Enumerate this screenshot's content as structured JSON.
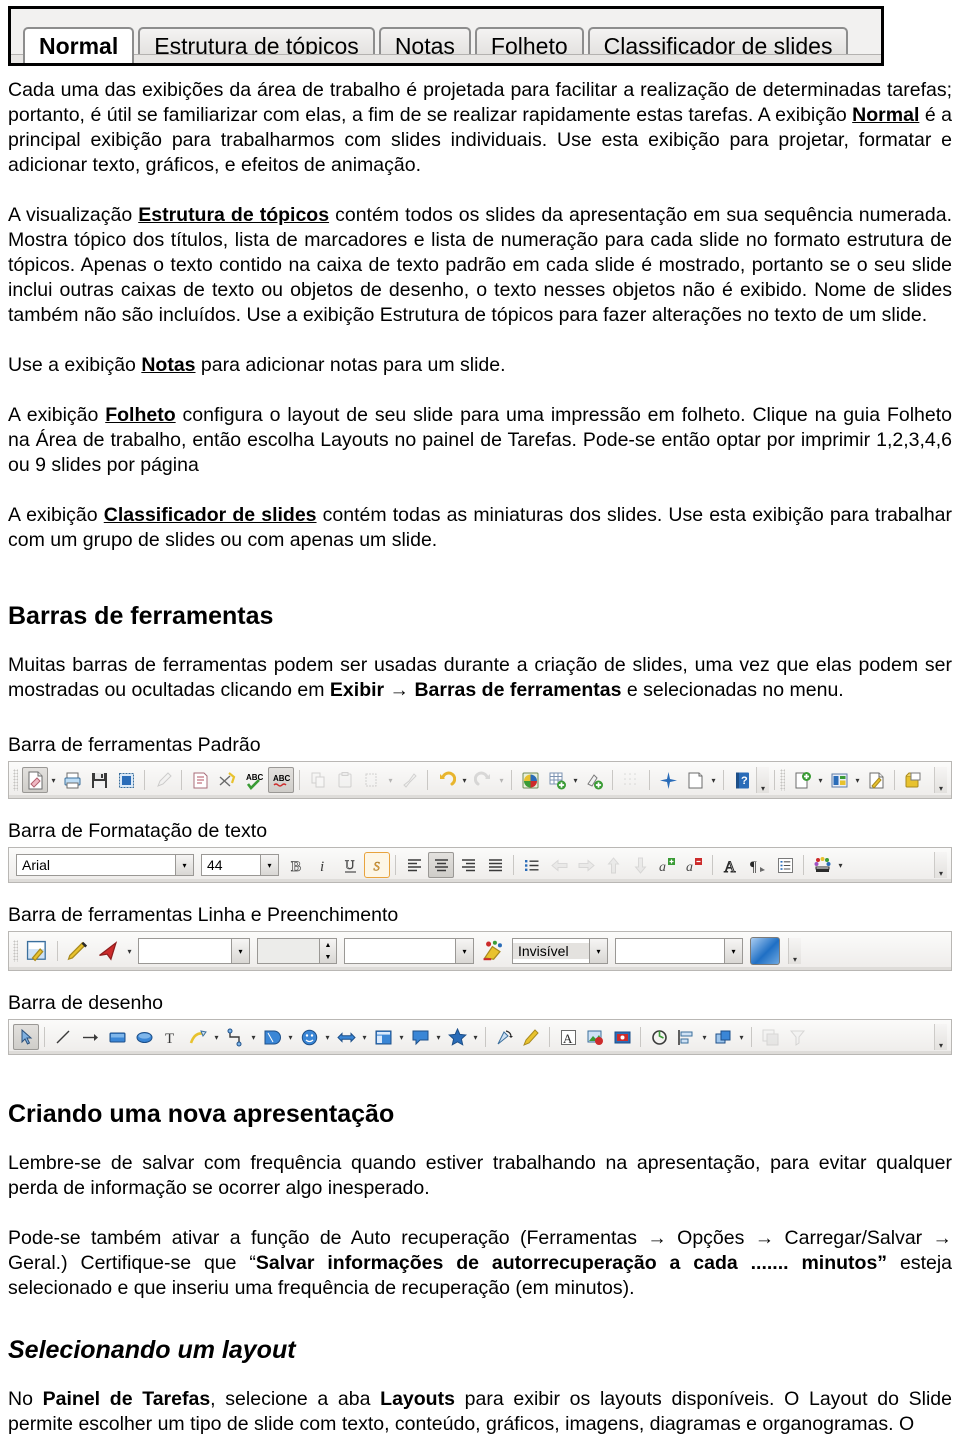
{
  "view_tabs": {
    "items": [
      {
        "label": "Normal",
        "active": true
      },
      {
        "label": "Estrutura de tópicos",
        "active": false
      },
      {
        "label": "Notas",
        "active": false
      },
      {
        "label": "Folheto",
        "active": false
      },
      {
        "label": "Classificador de slides",
        "active": false
      }
    ]
  },
  "body": {
    "p1_a": "Cada uma das  exibições  da área de trabalho  é  projetada para facilitar a realização de determinadas tarefas; portanto, é útil se familiarizar com elas, a fim de se realizar rapidamente estas tarefas. A exibição ",
    "p1_term": "Normal",
    "p1_b": " é a principal exibição para trabalharmos com slides individuais. Use esta exibição para projetar, formatar e adicionar texto, gráficos, e efeitos de animação.",
    "p2_a": "A visualização ",
    "p2_term": "Estrutura de tópicos",
    "p2_b": " contém todos os slides da apresentação em sua sequência numerada. Mostra tópico dos títulos, lista de marcadores e lista de numeração para cada  slide no formato estrutura de tópicos. Apenas o texto contido na caixa de texto padrão em cada slide é mostrado, portanto se o seu slide inclui outras caixas de texto ou objetos de desenho, o texto nesses objetos não é exibido. Nome de slides também não são incluídos. Use a exibição Estrutura de tópicos para fazer alterações no texto de um slide.",
    "p3_a": "Use a exibição ",
    "p3_term": "Notas",
    "p3_b": " para adicionar notas para um slide.",
    "p4_a": "A exibição ",
    "p4_term": "Folheto",
    "p4_b": " configura o layout de seu slide para uma impressão em folheto. Clique na guia Folheto na Área de trabalho, então escolha Layouts no painel de Tarefas. Pode-se então optar por imprimir 1,2,3,4,6 ou 9 slides por página",
    "p5_a": "A exibição ",
    "p5_term": "Classificador de slides",
    "p5_b": " contém todas as miniaturas dos slides. Use esta exibição para trabalhar com um grupo de slides ou com apenas um slide.",
    "h_toolbars": "Barras de ferramentas",
    "p6_a": "Muitas barras de ferramentas podem ser usadas durante a criação de slides, uma vez que elas podem ser mostradas ou ocultadas clicando em ",
    "p6_b1": "Exibir",
    "p6_arrow": " → ",
    "p6_b2": "Barras de ferramentas",
    "p6_c": " e selecionadas no menu.",
    "cap_standard": "Barra de ferramentas Padrão",
    "cap_textformat": "Barra de Formatação de texto",
    "cap_linefill": "Barra de ferramentas Linha e Preenchimento",
    "cap_drawing": "Barra de desenho",
    "h_newpres": "Criando uma nova apresentação",
    "p7": "Lembre-se de salvar com frequência quando estiver trabalhando  na apresentação, para evitar qualquer perda de informação se ocorrer algo inesperado.",
    "p8_a": "Pode-se também ativar a função de Auto recuperação (Ferramentas → Opções → Carregar/Salvar → Geral.) Certifique-se que  “",
    "p8_bold": "Salvar informações de autorrecuperação a cada ....... minutos”",
    "p8_b": " esteja selecionado e que inseriu uma frequência de recuperação (em minutos).",
    "h_layout": "Selecionando um layout",
    "p9_a": "No ",
    "p9_b1": "Painel de Tarefas",
    "p9_mid": ", selecione a aba ",
    "p9_b2": "Layouts",
    "p9_c": " para exibir os layouts disponíveis. O Layout do Slide permite escolher um tipo de slide com texto, conteúdo, gráficos, imagens, diagramas e organogramas. O"
  },
  "toolbars": {
    "standard": {
      "name": "Barra de ferramentas Padrão",
      "items": [
        {
          "icon": "new-document-icon",
          "state": "selected"
        },
        {
          "icon": "dropdown-caret-icon",
          "state": "caret"
        },
        {
          "icon": "print-icon",
          "state": "normal"
        },
        {
          "icon": "save-icon",
          "state": "normal"
        },
        {
          "icon": "export-pdf-icon",
          "state": "normal"
        },
        {
          "icon": "separator",
          "state": "sep"
        },
        {
          "icon": "edit-file-icon",
          "state": "disabled"
        },
        {
          "icon": "separator",
          "state": "sep"
        },
        {
          "icon": "print-preview-icon",
          "state": "normal"
        },
        {
          "icon": "cut-icon",
          "state": "normal"
        },
        {
          "icon": "spelling-icon",
          "state": "normal"
        },
        {
          "icon": "autospellcheck-icon",
          "state": "selected"
        },
        {
          "icon": "separator",
          "state": "sep"
        },
        {
          "icon": "copy-icon",
          "state": "disabled"
        },
        {
          "icon": "paste-icon",
          "state": "disabled"
        },
        {
          "icon": "paste-special-icon",
          "state": "disabled"
        },
        {
          "icon": "dropdown-caret-icon",
          "state": "caret-disabled"
        },
        {
          "icon": "clone-formatting-icon",
          "state": "disabled"
        },
        {
          "icon": "separator",
          "state": "sep"
        },
        {
          "icon": "undo-icon",
          "state": "normal"
        },
        {
          "icon": "dropdown-caret-icon",
          "state": "caret"
        },
        {
          "icon": "redo-icon",
          "state": "disabled"
        },
        {
          "icon": "dropdown-caret-icon",
          "state": "caret-disabled"
        },
        {
          "icon": "separator",
          "state": "sep"
        },
        {
          "icon": "insert-chart-icon",
          "state": "normal"
        },
        {
          "icon": "insert-table-icon",
          "state": "normal"
        },
        {
          "icon": "dropdown-caret-icon",
          "state": "caret"
        },
        {
          "icon": "insert-image-icon",
          "state": "normal"
        },
        {
          "icon": "separator",
          "state": "sep"
        },
        {
          "icon": "grid-icon",
          "state": "disabled"
        },
        {
          "icon": "separator",
          "state": "sep"
        },
        {
          "icon": "effects-icon",
          "state": "normal"
        },
        {
          "icon": "slide-show-icon",
          "state": "normal"
        },
        {
          "icon": "dropdown-caret-icon",
          "state": "caret"
        },
        {
          "icon": "separator",
          "state": "sep"
        },
        {
          "icon": "help-icon",
          "state": "normal"
        },
        {
          "icon": "endcaret",
          "state": "endcaret"
        },
        {
          "icon": "separator",
          "state": "sep"
        },
        {
          "icon": "new-slide-icon",
          "state": "normal"
        },
        {
          "icon": "dropdown-caret-icon",
          "state": "caret"
        },
        {
          "icon": "slide-layout-icon",
          "state": "normal"
        },
        {
          "icon": "dropdown-caret-icon",
          "state": "caret"
        },
        {
          "icon": "slide-design-icon",
          "state": "normal"
        },
        {
          "icon": "separator",
          "state": "sep"
        },
        {
          "icon": "master-slide-icon",
          "state": "normal"
        },
        {
          "icon": "endcaret",
          "state": "endcaret"
        }
      ]
    },
    "text_format": {
      "name": "Barra de Formatação de texto",
      "font_name": "Arial",
      "font_size": "44",
      "items": [
        {
          "icon": "bold-icon",
          "label": "B",
          "state": "normal"
        },
        {
          "icon": "italic-icon",
          "label": "i",
          "state": "normal"
        },
        {
          "icon": "underline-icon",
          "label": "U",
          "state": "normal"
        },
        {
          "icon": "shadow-icon",
          "label": "S",
          "state": "highlighted"
        },
        {
          "icon": "separator",
          "state": "sep"
        },
        {
          "icon": "align-left-icon",
          "state": "normal"
        },
        {
          "icon": "align-center-icon",
          "state": "selected"
        },
        {
          "icon": "align-right-icon",
          "state": "normal"
        },
        {
          "icon": "align-justify-icon",
          "state": "normal"
        },
        {
          "icon": "separator",
          "state": "sep"
        },
        {
          "icon": "bullet-list-icon",
          "state": "normal"
        },
        {
          "icon": "promote-icon",
          "state": "disabled"
        },
        {
          "icon": "demote-icon",
          "state": "disabled"
        },
        {
          "icon": "move-up-icon",
          "state": "disabled"
        },
        {
          "icon": "move-down-icon",
          "state": "disabled"
        },
        {
          "icon": "increase-font-icon",
          "state": "normal"
        },
        {
          "icon": "decrease-font-icon",
          "state": "normal"
        },
        {
          "icon": "separator",
          "state": "sep"
        },
        {
          "icon": "fontwork-icon",
          "state": "normal"
        },
        {
          "icon": "formatting-marks-icon",
          "state": "normal"
        },
        {
          "icon": "outline-icon",
          "state": "normal"
        },
        {
          "icon": "separator",
          "state": "sep"
        },
        {
          "icon": "font-color-icon",
          "state": "normal"
        },
        {
          "icon": "dropdown-caret-icon",
          "state": "caret"
        },
        {
          "icon": "endcaret",
          "state": "endcaret"
        }
      ]
    },
    "line_fill": {
      "name": "Barra de ferramentas Linha e Preenchimento",
      "line_style_value": "",
      "line_width_value": "",
      "line_color_value": "",
      "area_style_value": "Invisível",
      "area_fill_value": "",
      "items": [
        {
          "icon": "line-fill-dialog-icon",
          "state": "normal"
        },
        {
          "icon": "separator",
          "state": "sep"
        },
        {
          "icon": "line-style-dialog-icon",
          "state": "normal"
        },
        {
          "icon": "arrow-style-icon",
          "state": "normal"
        },
        {
          "icon": "dropdown-caret-icon",
          "state": "caret"
        },
        {
          "icon": "line-style-combo",
          "state": "combo"
        },
        {
          "icon": "line-width-spin",
          "state": "spin"
        },
        {
          "icon": "line-color-combo",
          "state": "combo"
        },
        {
          "icon": "area-dialog-icon",
          "state": "normal"
        },
        {
          "icon": "area-style-combo",
          "state": "combo"
        },
        {
          "icon": "area-fill-combo",
          "state": "combo"
        },
        {
          "icon": "shadow-swatch",
          "state": "swatch"
        },
        {
          "icon": "endcaret",
          "state": "endcaret"
        }
      ]
    },
    "drawing": {
      "name": "Barra de desenho",
      "items": [
        {
          "icon": "select-arrow-icon",
          "state": "selected"
        },
        {
          "icon": "separator",
          "state": "sep"
        },
        {
          "icon": "line-icon",
          "state": "normal"
        },
        {
          "icon": "arrow-line-icon",
          "state": "normal"
        },
        {
          "icon": "rectangle-icon",
          "state": "normal"
        },
        {
          "icon": "ellipse-icon",
          "state": "normal"
        },
        {
          "icon": "text-box-icon",
          "state": "normal"
        },
        {
          "icon": "curve-icon",
          "state": "normal"
        },
        {
          "icon": "dropdown-caret-icon",
          "state": "caret"
        },
        {
          "icon": "connector-icon",
          "state": "normal"
        },
        {
          "icon": "dropdown-caret-icon",
          "state": "caret"
        },
        {
          "icon": "basic-shapes-icon",
          "state": "normal"
        },
        {
          "icon": "dropdown-caret-icon",
          "state": "caret"
        },
        {
          "icon": "symbol-shapes-icon",
          "state": "normal"
        },
        {
          "icon": "dropdown-caret-icon",
          "state": "caret"
        },
        {
          "icon": "block-arrows-icon",
          "state": "normal"
        },
        {
          "icon": "dropdown-caret-icon",
          "state": "caret"
        },
        {
          "icon": "flowchart-icon",
          "state": "normal"
        },
        {
          "icon": "dropdown-caret-icon",
          "state": "caret"
        },
        {
          "icon": "callouts-icon",
          "state": "normal"
        },
        {
          "icon": "dropdown-caret-icon",
          "state": "caret"
        },
        {
          "icon": "stars-icon",
          "state": "normal"
        },
        {
          "icon": "dropdown-caret-icon",
          "state": "caret"
        },
        {
          "icon": "separator",
          "state": "sep"
        },
        {
          "icon": "rotate-icon",
          "state": "normal"
        },
        {
          "icon": "edit-points-icon",
          "state": "normal"
        },
        {
          "icon": "separator",
          "state": "sep"
        },
        {
          "icon": "fontwork-gallery-icon",
          "state": "normal"
        },
        {
          "icon": "from-file-image-icon",
          "state": "normal"
        },
        {
          "icon": "gallery-icon",
          "state": "normal"
        },
        {
          "icon": "separator",
          "state": "sep"
        },
        {
          "icon": "rotate-mode-icon",
          "state": "normal"
        },
        {
          "icon": "alignment-icon",
          "state": "normal"
        },
        {
          "icon": "dropdown-caret-icon",
          "state": "caret"
        },
        {
          "icon": "arrange-icon",
          "state": "normal"
        },
        {
          "icon": "dropdown-caret-icon",
          "state": "caret"
        },
        {
          "icon": "separator",
          "state": "sep"
        },
        {
          "icon": "shadow-toggle-icon",
          "state": "disabled"
        },
        {
          "icon": "filter-icon",
          "state": "disabled"
        },
        {
          "icon": "endcaret",
          "state": "endcaret"
        }
      ]
    }
  },
  "colors": {
    "page_background": "#ffffff",
    "text": "#000000",
    "toolbar_face": "#eeecea",
    "toolbar_border": "#b9b7b4",
    "highlight_orange": "#e8a33d",
    "accent_blue": "#2a6cb8",
    "accent_green": "#3a9b35",
    "accent_red": "#cc2b2b",
    "accent_yellow": "#e8c22e"
  }
}
